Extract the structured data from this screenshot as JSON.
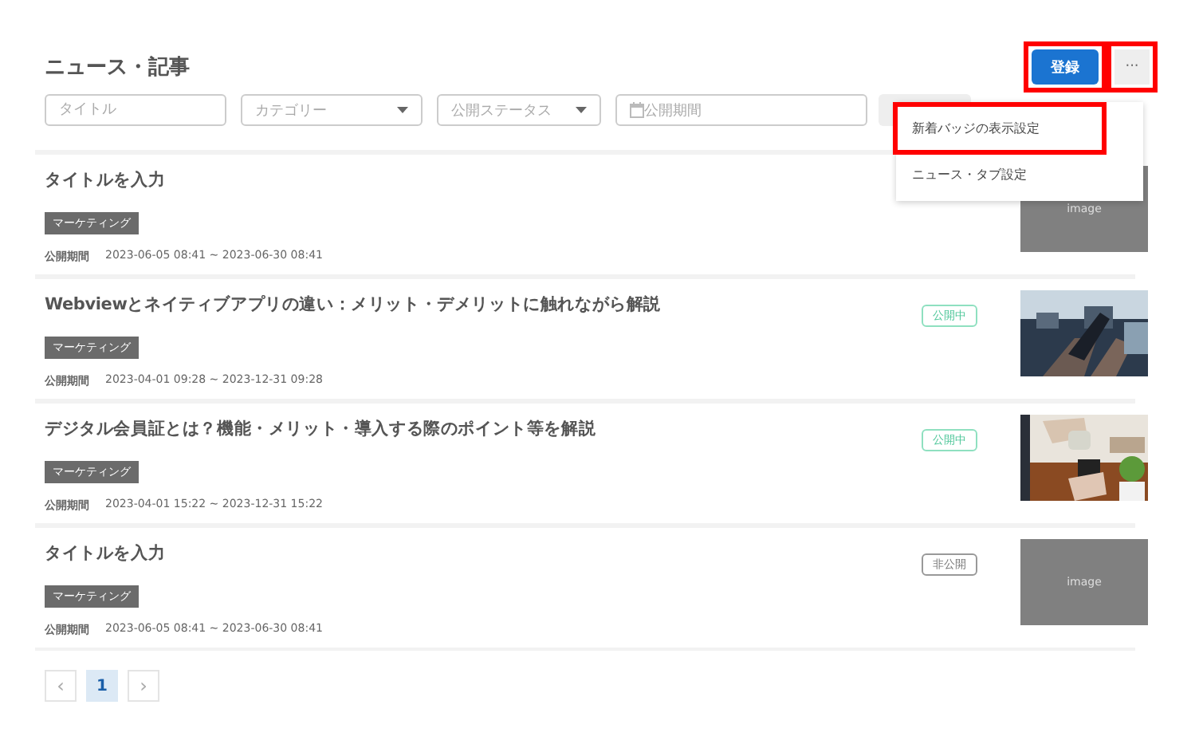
{
  "header": {
    "title": "ニュース・記事",
    "register_button": {
      "label": "登録",
      "highlighted": true
    },
    "more_button": {
      "label": "···",
      "highlighted": true
    }
  },
  "filters": {
    "title": {
      "placeholder": "タイトル"
    },
    "category": {
      "placeholder": "カテゴリー"
    },
    "status": {
      "placeholder": "公開ステータス"
    },
    "period": {
      "placeholder": "公開期間"
    }
  },
  "menu": {
    "items": [
      {
        "label": "新着バッジの表示設定",
        "highlighted": true
      },
      {
        "label": "ニュース・タブ設定",
        "highlighted": false
      }
    ]
  },
  "articles": [
    {
      "title": "タイトルを入力",
      "tag": "マーケティング",
      "period_label": "公開期間",
      "period": "2023-06-05 08:41 ~ 2023-06-30 08:41",
      "thumbnail": {
        "kind": "placeholder",
        "label": "image"
      }
    },
    {
      "title": "Webviewとネイティブアプリの違い：メリット・デメリットに触れながら解説",
      "tag": "マーケティング",
      "period_label": "公開期間",
      "period": "2023-04-01 09:28 ~ 2023-12-31 09:28",
      "status": {
        "label": "公開中",
        "kind": "published"
      }
    },
    {
      "title": "デジタル会員証とは？機能・メリット・導入する際のポイント等を解説",
      "tag": "マーケティング",
      "period_label": "公開期間",
      "period": "2023-04-01 15:22 ~ 2023-12-31 15:22",
      "status": {
        "label": "公開中",
        "kind": "published"
      }
    },
    {
      "title": "タイトルを入力",
      "tag": "マーケティング",
      "period_label": "公開期間",
      "period": "2023-06-05 08:41 ~ 2023-06-30 08:41",
      "status": {
        "label": "非公開",
        "kind": "unpublished"
      },
      "thumbnail": {
        "kind": "placeholder",
        "label": "image"
      }
    }
  ],
  "pagination": {
    "prev": "‹",
    "pages": [
      {
        "label": "1",
        "selected": true
      }
    ],
    "next": "›"
  }
}
